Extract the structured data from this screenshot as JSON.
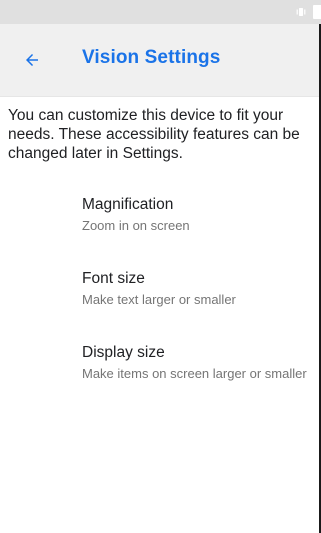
{
  "header": {
    "title": "Vision Settings"
  },
  "description": "You can customize this device to fit your needs. These accessibility features can be changed later in Settings.",
  "options": [
    {
      "title": "Magnification",
      "subtitle": "Zoom in on screen"
    },
    {
      "title": "Font size",
      "subtitle": "Make text larger or smaller"
    },
    {
      "title": "Display size",
      "subtitle": "Make items on screen larger or smaller"
    }
  ],
  "colors": {
    "accent": "#1a73e8",
    "app_bar": "#f0f0f0",
    "status_bar": "#e0e0e0",
    "primary_text": "#202124",
    "secondary_text": "#757575"
  },
  "icons": {
    "back": "arrow-left-icon",
    "status_vibrate": "vibrate-icon",
    "status_battery": "battery-icon"
  }
}
